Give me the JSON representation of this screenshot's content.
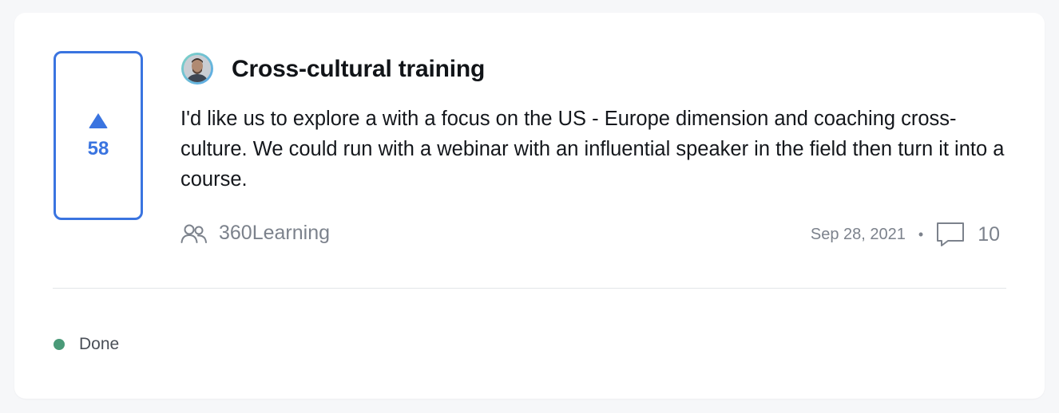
{
  "idea": {
    "votes": "58",
    "title": "Cross-cultural training",
    "description": "I'd like us to explore a with a focus on the US - Europe dimension and coaching cross-culture. We could run with a webinar with an influential speaker in the field then turn it into a course.",
    "team": "360Learning",
    "date": "Sep 28, 2021",
    "separator": "•",
    "comments": "10"
  },
  "status": {
    "label": "Done",
    "color": "#4a9a78"
  },
  "colors": {
    "accent": "#3a74e0",
    "muted_text": "#7c828c"
  },
  "icons": {
    "upvote": "triangle-up",
    "team": "users-icon",
    "comment": "speech-bubble-icon"
  }
}
